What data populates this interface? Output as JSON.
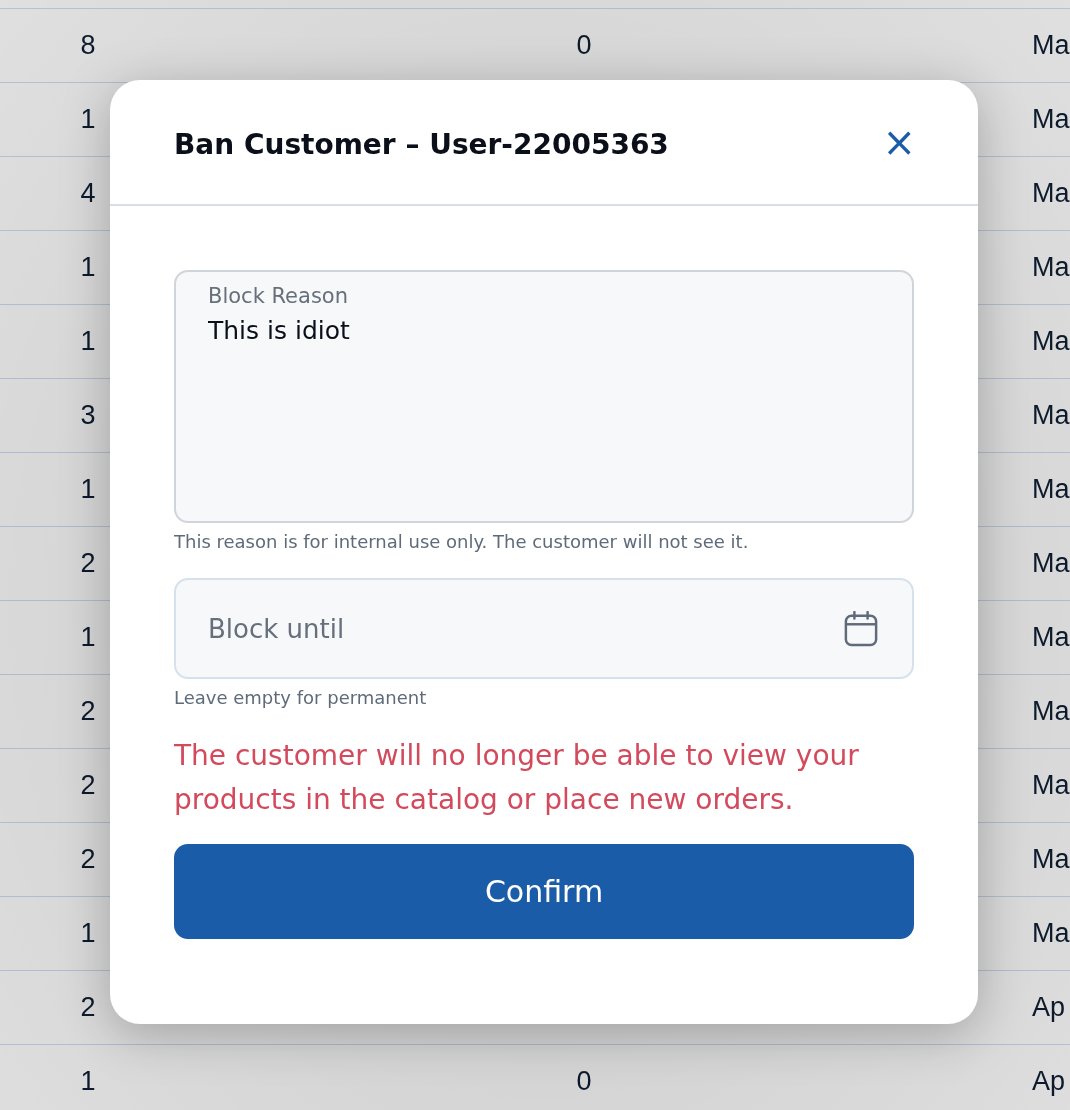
{
  "table": {
    "rows": [
      {
        "column_1": "8",
        "column_2": "0",
        "column_3": "Ma"
      },
      {
        "column_1": "1",
        "column_3": "Ma"
      },
      {
        "column_1": "4",
        "column_3": "Ma"
      },
      {
        "column_1": "1",
        "column_3": "Ma"
      },
      {
        "column_1": "1",
        "column_3": "Ma"
      },
      {
        "column_1": "3",
        "column_3": "Ma"
      },
      {
        "column_1": "1",
        "column_3": "Ma"
      },
      {
        "column_1": "2",
        "column_3": "Ma"
      },
      {
        "column_1": "1",
        "column_3": "Ma"
      },
      {
        "column_1": "2",
        "column_3": "Ma"
      },
      {
        "column_1": "2",
        "column_3": "Ma"
      },
      {
        "column_1": "2",
        "column_3": "Ma"
      },
      {
        "column_1": "1",
        "column_3": "Ma"
      },
      {
        "column_1": "2",
        "column_3": "Ap"
      },
      {
        "column_1": "1",
        "column_2": "0",
        "column_3": "Ap"
      }
    ]
  },
  "dialog": {
    "title": "Ban Customer – User-22005363",
    "close_icon": "×",
    "reason_field": {
      "label": "Block Reason",
      "value": "This is idiot",
      "hint": "This reason is for internal use only. The customer will not see it."
    },
    "date_field": {
      "placeholder": "Block until",
      "hint": "Leave empty for permanent"
    },
    "warning": "The customer will no longer be able to view your products in the catalog or place new orders.",
    "confirm_button": "Confirm"
  }
}
